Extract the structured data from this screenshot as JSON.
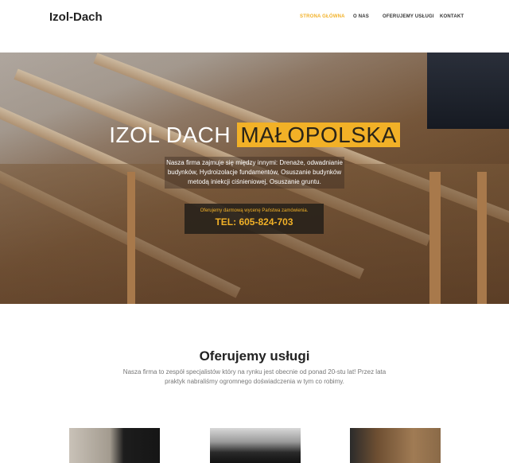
{
  "header": {
    "logo": "Izol-Dach",
    "nav": [
      {
        "label": "STRONA GŁÓWNA",
        "active": true
      },
      {
        "label": "O NAS",
        "active": false
      },
      {
        "label": "OFERUJEMY USŁUGI",
        "active": false
      },
      {
        "label": "KONTAKT",
        "active": false
      }
    ]
  },
  "hero": {
    "title_main": "IZOL DACH",
    "title_highlight": "MAŁOPOLSKA",
    "description": "Nasza firma zajmuje się między innymi: Drenaże, odwadnianie budynków, Hydroizolacje fundamentów, Osuszanie budynków metodą iniekcji ciśnieniowej, Osuszanie gruntu.",
    "cta_text": "Oferujemy darmową wycenę Państwa zamówienia.",
    "cta_phone": "TEL: 605-824-703"
  },
  "services": {
    "title": "Oferujemy usługi",
    "text": "Nasza firma to zespół specjalistów który na rynku jest obecnie od ponad 20-stu lat! Przez lata praktyk nabraliśmy ogromnego doświadczenia w tym co robimy."
  },
  "colors": {
    "accent": "#f2b127",
    "dark": "#222222"
  }
}
